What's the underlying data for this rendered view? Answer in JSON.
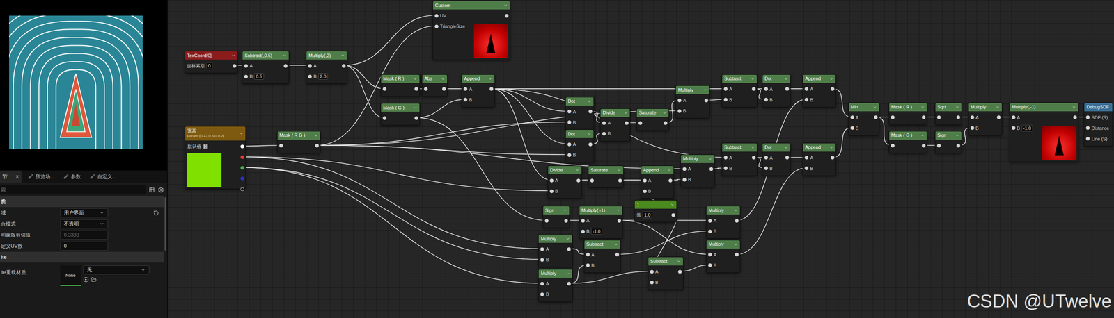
{
  "details": {
    "tabs": [
      {
        "label": "节",
        "selected": true,
        "close": "×"
      },
      {
        "label": "预览场...",
        "selected": false
      },
      {
        "label": "参数",
        "selected": false
      },
      {
        "label": "自定义...",
        "selected": false
      }
    ],
    "search": {
      "placeholder": "索"
    },
    "rows": [
      {
        "kind": "section",
        "label": "质"
      },
      {
        "kind": "dropdown",
        "label": "域",
        "value": "用户界面",
        "resettable": true
      },
      {
        "kind": "dropdown",
        "label": "合模式",
        "value": "不透明",
        "resettable": false
      },
      {
        "kind": "field",
        "label": "明蒙版剪切值",
        "value": "0.3333",
        "disabled": true
      },
      {
        "kind": "field",
        "label": "定义UV数",
        "value": "0",
        "disabled": false
      },
      {
        "kind": "section",
        "label": "ite"
      },
      {
        "kind": "asset",
        "label": "ite重载材质",
        "thumb": "None",
        "value": "无"
      }
    ]
  },
  "graph": {
    "nodes": [
      {
        "title": "TexCoord[0]",
        "kind": "constant",
        "color": "#8a1c1c",
        "inputs": [
          {
            "label": "坐标索引",
            "value": "0"
          }
        ]
      },
      {
        "title": "Subtract(,0.5)",
        "kind": "op",
        "color": "#4f7d49",
        "inputs": [
          {
            "label": "A"
          },
          {
            "label": "B",
            "value": "0.5"
          }
        ]
      },
      {
        "title": "Multiply(,2)",
        "kind": "op",
        "color": "#4f7d49",
        "inputs": [
          {
            "label": "A"
          },
          {
            "label": "B",
            "value": "2.0"
          }
        ]
      },
      {
        "title": "Custom",
        "kind": "preview",
        "color": "#4f7d49",
        "inputs": [
          {
            "label": "UV"
          },
          {
            "label": "TriangleSize"
          }
        ]
      },
      {
        "title": "Mask ( R )",
        "kind": "op",
        "color": "#4f7d49",
        "inputs": [
          {
            "label": ""
          }
        ]
      },
      {
        "title": "Abs",
        "kind": "op",
        "color": "#4f7d49",
        "inputs": [
          {
            "label": ""
          }
        ]
      },
      {
        "title": "Mask ( G )",
        "kind": "op",
        "color": "#4f7d49",
        "inputs": [
          {
            "label": ""
          }
        ]
      },
      {
        "title": "Append",
        "kind": "op",
        "color": "#4f7d49",
        "inputs": [
          {
            "label": "A"
          },
          {
            "label": "B"
          }
        ]
      },
      {
        "title": "宽高",
        "subtitle": "Param (0.22,0.6,0.0,2)",
        "kind": "param",
        "color": "#7d5a10",
        "swatch": "#80e000",
        "inputs": [
          {
            "label": "默认值"
          }
        ],
        "outputs": [
          {
            "color": "#ffffff",
            "filled": true
          },
          {
            "color": "#e53935",
            "filled": true
          },
          {
            "color": "#43b047",
            "filled": true
          },
          {
            "color": "#2933c4",
            "filled": true
          },
          {
            "color": "#d0d0d0",
            "filled": false
          }
        ]
      },
      {
        "title": "Mask ( R G )",
        "kind": "op",
        "color": "#4f7d49",
        "inputs": [
          {
            "label": ""
          }
        ]
      },
      {
        "title": "Dot",
        "kind": "op",
        "color": "#4f7d49",
        "inputs": [
          {
            "label": "A"
          },
          {
            "label": "B"
          }
        ]
      },
      {
        "title": "Dot",
        "kind": "op",
        "color": "#4f7d49",
        "inputs": [
          {
            "label": "A"
          },
          {
            "label": "B"
          }
        ]
      },
      {
        "title": "Divide",
        "kind": "op",
        "color": "#4f7d49",
        "inputs": [
          {
            "label": "A"
          },
          {
            "label": "B"
          }
        ]
      },
      {
        "title": "Saturate",
        "kind": "op",
        "color": "#4f7d49",
        "inputs": [
          {
            "label": ""
          }
        ]
      },
      {
        "title": "Multiply",
        "kind": "op",
        "color": "#4f7d49",
        "inputs": [
          {
            "label": "A"
          },
          {
            "label": "B"
          }
        ]
      },
      {
        "title": "Subtract",
        "kind": "op",
        "color": "#4f7d49",
        "inputs": [
          {
            "label": "A"
          },
          {
            "label": "B"
          }
        ]
      },
      {
        "title": "Dot",
        "kind": "op",
        "color": "#4f7d49",
        "inputs": [
          {
            "label": "A"
          },
          {
            "label": "B"
          }
        ]
      },
      {
        "title": "Append",
        "kind": "op",
        "color": "#4f7d49",
        "inputs": [
          {
            "label": "A"
          },
          {
            "label": "B"
          }
        ]
      },
      {
        "title": "Multiply",
        "kind": "op",
        "color": "#4f7d49",
        "inputs": [
          {
            "label": "A"
          },
          {
            "label": "B"
          }
        ]
      },
      {
        "title": "Subtract",
        "kind": "op",
        "color": "#4f7d49",
        "inputs": [
          {
            "label": "A"
          },
          {
            "label": "B"
          }
        ]
      },
      {
        "title": "Dot",
        "kind": "op",
        "color": "#4f7d49",
        "inputs": [
          {
            "label": "A"
          },
          {
            "label": "B"
          }
        ]
      },
      {
        "title": "Append",
        "kind": "op",
        "color": "#4f7d49",
        "inputs": [
          {
            "label": "A"
          },
          {
            "label": "B"
          }
        ]
      },
      {
        "title": "Divide",
        "kind": "op",
        "color": "#4f7d49",
        "inputs": [
          {
            "label": "A"
          },
          {
            "label": "B"
          }
        ]
      },
      {
        "title": "Saturate",
        "kind": "op",
        "color": "#4f7d49",
        "inputs": [
          {
            "label": ""
          }
        ]
      },
      {
        "title": "Append",
        "kind": "op",
        "color": "#4f7d49",
        "inputs": [
          {
            "label": "A"
          },
          {
            "label": "B"
          }
        ]
      },
      {
        "title": "1",
        "kind": "constant",
        "color": "#4a8a1e",
        "inputs": [
          {
            "label": "值",
            "value": "1.0"
          }
        ]
      },
      {
        "title": "Sign",
        "kind": "op",
        "color": "#4f7d49",
        "inputs": [
          {
            "label": ""
          }
        ]
      },
      {
        "title": "Multiply(,-1)",
        "kind": "op",
        "color": "#4f7d49",
        "inputs": [
          {
            "label": "A"
          },
          {
            "label": "B",
            "value": "-1.0"
          }
        ]
      },
      {
        "title": "Multiply",
        "kind": "op",
        "color": "#4f7d49",
        "inputs": [
          {
            "label": "A"
          },
          {
            "label": "B"
          }
        ]
      },
      {
        "title": "Subtract",
        "kind": "op",
        "color": "#4f7d49",
        "inputs": [
          {
            "label": "A"
          },
          {
            "label": "B"
          }
        ]
      },
      {
        "title": "Multiply",
        "kind": "op",
        "color": "#4f7d49",
        "inputs": [
          {
            "label": "A"
          },
          {
            "label": "B"
          }
        ]
      },
      {
        "title": "Subtract",
        "kind": "op",
        "color": "#4f7d49",
        "inputs": [
          {
            "label": "A"
          },
          {
            "label": "B"
          }
        ]
      },
      {
        "title": "Multiply",
        "kind": "op",
        "color": "#4f7d49",
        "inputs": [
          {
            "label": "A"
          },
          {
            "label": "B"
          }
        ]
      },
      {
        "title": "Multiply",
        "kind": "op",
        "color": "#4f7d49",
        "inputs": [
          {
            "label": "A"
          },
          {
            "label": "B"
          }
        ]
      },
      {
        "title": "Min",
        "kind": "op",
        "color": "#4f7d49",
        "inputs": [
          {
            "label": "A"
          },
          {
            "label": "B"
          }
        ]
      },
      {
        "title": "Mask ( R )",
        "kind": "op",
        "color": "#4f7d49",
        "inputs": [
          {
            "label": ""
          }
        ]
      },
      {
        "title": "Sqrt",
        "kind": "op",
        "color": "#4f7d49",
        "inputs": [
          {
            "label": ""
          }
        ]
      },
      {
        "title": "Multiply",
        "kind": "op",
        "color": "#4f7d49",
        "inputs": [
          {
            "label": "A"
          },
          {
            "label": "B"
          }
        ]
      },
      {
        "title": "Mask ( G )",
        "kind": "op",
        "color": "#4f7d49",
        "inputs": [
          {
            "label": ""
          }
        ]
      },
      {
        "title": "Sign",
        "kind": "op",
        "color": "#4f7d49",
        "inputs": [
          {
            "label": ""
          }
        ]
      },
      {
        "title": "Multiply(,-1)",
        "kind": "preview",
        "color": "#4f7d49",
        "inputs": [
          {
            "label": "A"
          },
          {
            "label": "B",
            "value": "-1.0"
          }
        ]
      },
      {
        "title": "DebugSDF",
        "kind": "sink",
        "color": "#3b6f93",
        "inputs": [
          {
            "label": "SDF (S)"
          },
          {
            "label": "Distance"
          },
          {
            "label": "Line (S)"
          }
        ]
      }
    ],
    "edges": [
      {
        "from": 0,
        "to": 1,
        "pin": 0
      },
      {
        "from": 1,
        "to": 2,
        "pin": 0
      },
      {
        "from": 2,
        "to": 3,
        "pin": 0
      },
      {
        "from": 2,
        "to": 4,
        "pin": 0
      },
      {
        "from": 2,
        "to": 6,
        "pin": 0
      },
      {
        "from": 4,
        "to": 5,
        "pin": 0
      },
      {
        "from": 5,
        "to": 7,
        "pin": 0
      },
      {
        "from": 6,
        "to": 7,
        "pin": 1
      },
      {
        "from": 9,
        "to": 3,
        "pin": 1
      },
      {
        "from": 8,
        "to": 9,
        "pin": 0,
        "out": 0
      },
      {
        "from": 7,
        "to": 10,
        "pin": 0
      },
      {
        "from": 9,
        "to": 10,
        "pin": 1
      },
      {
        "from": 7,
        "to": 11,
        "pin": 0
      },
      {
        "from": 9,
        "to": 11,
        "pin": 1
      },
      {
        "from": 10,
        "to": 12,
        "pin": 0
      },
      {
        "from": 11,
        "to": 12,
        "pin": 1
      },
      {
        "from": 12,
        "to": 13,
        "pin": 0
      },
      {
        "from": 13,
        "to": 14,
        "pin": 0
      },
      {
        "from": 9,
        "to": 14,
        "pin": 1
      },
      {
        "from": 7,
        "to": 15,
        "pin": 0
      },
      {
        "from": 14,
        "to": 15,
        "pin": 1
      },
      {
        "from": 15,
        "to": 16,
        "pin": 0
      },
      {
        "from": 15,
        "to": 16,
        "pin": 1
      },
      {
        "from": 16,
        "to": 17,
        "pin": 0
      },
      {
        "from": 7,
        "to": 22,
        "pin": 0
      },
      {
        "from": 8,
        "to": 22,
        "pin": 1,
        "out": 1
      },
      {
        "from": 22,
        "to": 23,
        "pin": 0
      },
      {
        "from": 23,
        "to": 24,
        "pin": 0
      },
      {
        "from": 25,
        "to": 24,
        "pin": 1
      },
      {
        "from": 24,
        "to": 18,
        "pin": 1
      },
      {
        "from": 9,
        "to": 18,
        "pin": 0
      },
      {
        "from": 7,
        "to": 19,
        "pin": 0
      },
      {
        "from": 18,
        "to": 19,
        "pin": 1
      },
      {
        "from": 19,
        "to": 20,
        "pin": 0
      },
      {
        "from": 19,
        "to": 20,
        "pin": 1
      },
      {
        "from": 20,
        "to": 21,
        "pin": 0
      },
      {
        "from": 6,
        "to": 26,
        "pin": 0
      },
      {
        "from": 26,
        "to": 27,
        "pin": 0
      },
      {
        "from": 27,
        "to": 32,
        "pin": 0
      },
      {
        "from": 8,
        "to": 28,
        "pin": 0,
        "out": 1
      },
      {
        "from": 8,
        "to": 30,
        "pin": 0,
        "out": 2
      },
      {
        "from": 8,
        "to": 28,
        "pin": 1,
        "out": 2
      },
      {
        "from": 28,
        "to": 29,
        "pin": 0
      },
      {
        "from": 30,
        "to": 29,
        "pin": 1
      },
      {
        "from": 29,
        "to": 32,
        "pin": 1
      },
      {
        "from": 30,
        "to": 31,
        "pin": 0
      },
      {
        "from": 25,
        "to": 31,
        "pin": 1
      },
      {
        "from": 31,
        "to": 33,
        "pin": 1
      },
      {
        "from": 27,
        "to": 33,
        "pin": 0
      },
      {
        "from": 32,
        "to": 17,
        "pin": 1
      },
      {
        "from": 33,
        "to": 21,
        "pin": 1
      },
      {
        "from": 17,
        "to": 34,
        "pin": 0
      },
      {
        "from": 21,
        "to": 34,
        "pin": 1
      },
      {
        "from": 34,
        "to": 35,
        "pin": 0
      },
      {
        "from": 34,
        "to": 38,
        "pin": 0
      },
      {
        "from": 35,
        "to": 36,
        "pin": 0
      },
      {
        "from": 36,
        "to": 37,
        "pin": 0
      },
      {
        "from": 38,
        "to": 39,
        "pin": 0
      },
      {
        "from": 39,
        "to": 37,
        "pin": 1
      },
      {
        "from": 37,
        "to": 40,
        "pin": 0
      },
      {
        "from": 40,
        "to": 41,
        "pin": 0
      }
    ]
  },
  "watermark": "CSDN @UTwelve"
}
